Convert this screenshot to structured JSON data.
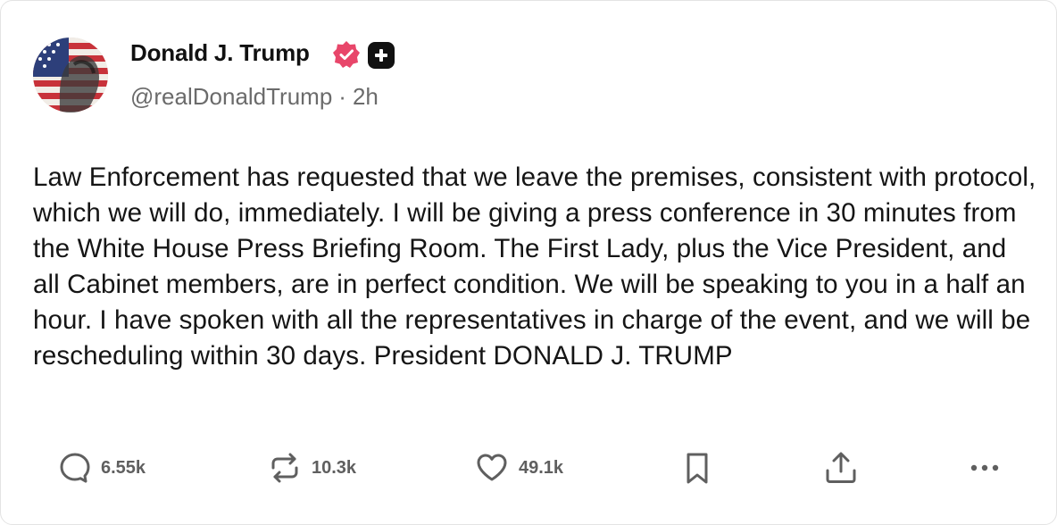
{
  "post": {
    "author": {
      "display_name": "Donald J. Trump",
      "handle": "@realDonaldTrump",
      "time_ago": "2h",
      "separator": "·",
      "avatar_icon": "avatar-flag-portrait",
      "verified_icon": "verified-badge-icon",
      "verified_color": "#e8466a",
      "plus_icon": "plus-square-icon"
    },
    "text": "Law Enforcement has requested that we leave the premises, consistent with protocol, which we will do, immediately. I will be giving a press conference in 30 minutes from the White House Press Briefing Room. The First Lady, plus the Vice President, and all Cabinet members, are in perfect condition. We will be speaking to you in a half an hour. I have spoken with all the representatives in charge of the event, and we will be rescheduling within 30 days. President DONALD J. TRUMP",
    "actions": {
      "replies": {
        "icon": "reply-bubble-icon",
        "count": "6.55k"
      },
      "retruths": {
        "icon": "repost-icon",
        "count": "10.3k"
      },
      "likes": {
        "icon": "heart-icon",
        "count": "49.1k"
      },
      "bookmark": {
        "icon": "bookmark-icon"
      },
      "share": {
        "icon": "share-icon"
      },
      "more": {
        "icon": "more-icon"
      }
    }
  },
  "colors": {
    "text": "#151515",
    "muted": "#6b6b6b",
    "icon": "#5f5f5f",
    "border": "#e3e3e3"
  }
}
